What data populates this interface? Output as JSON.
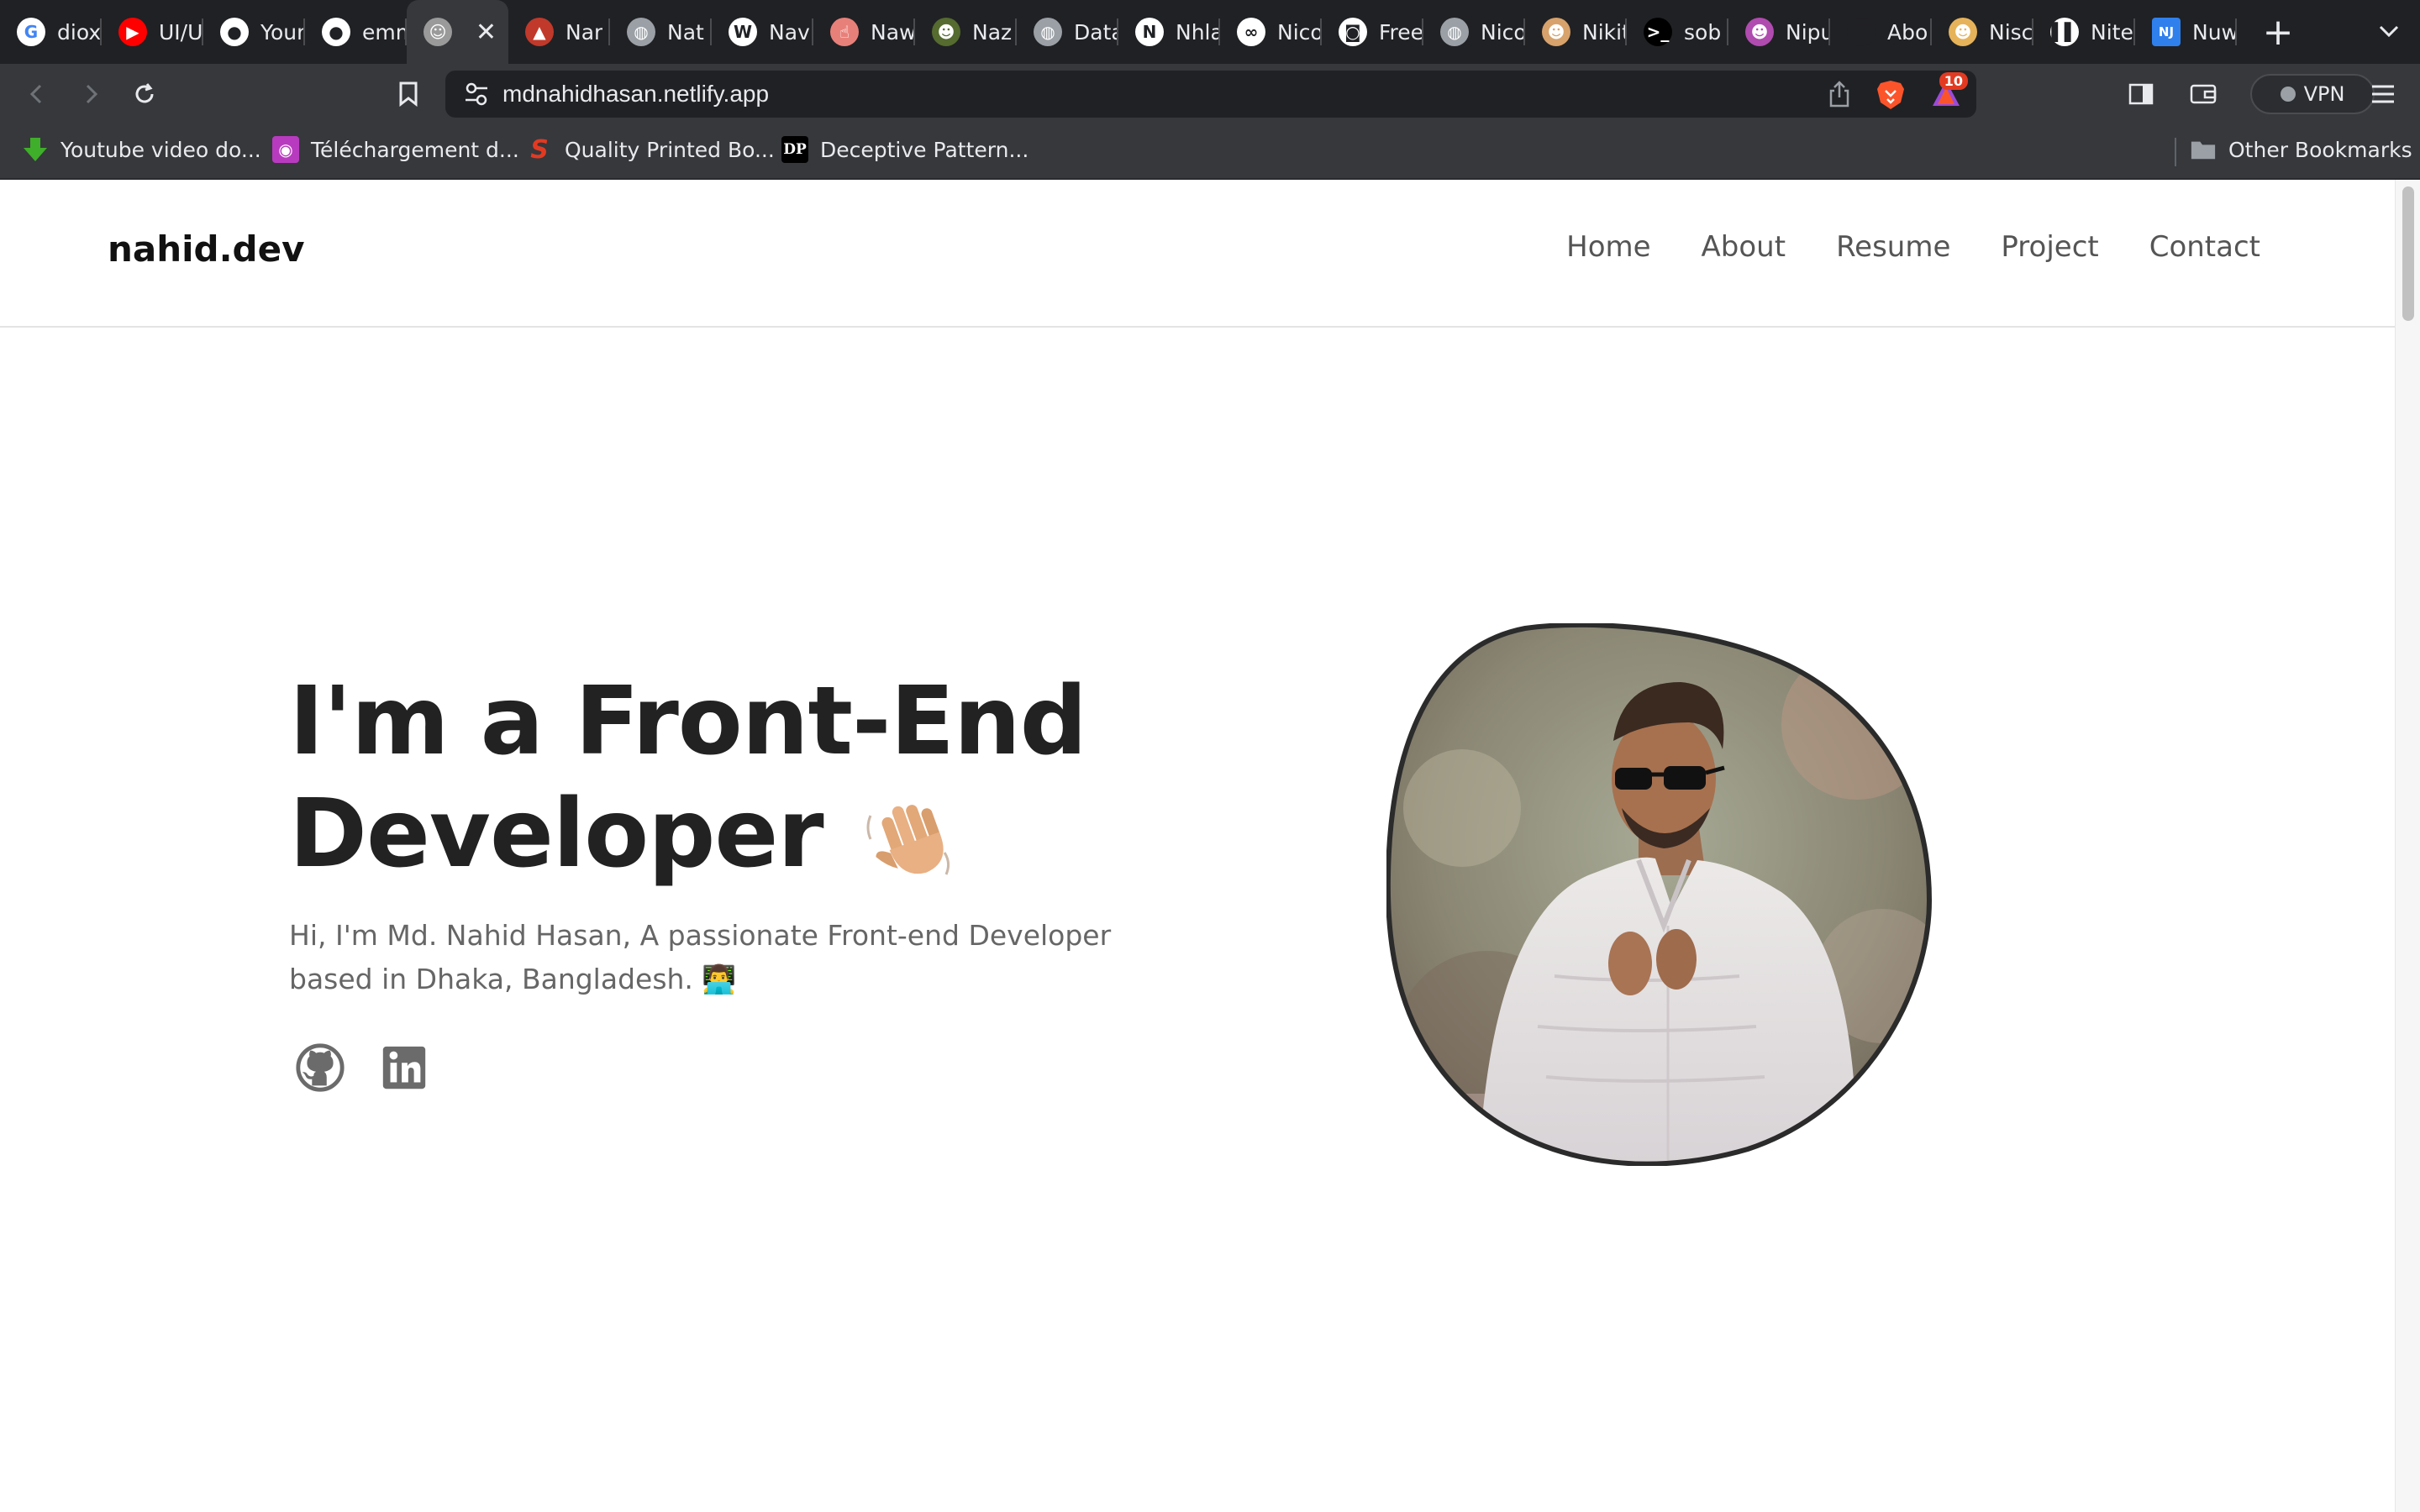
{
  "browser": {
    "tabs": [
      {
        "title": "diox",
        "favicon": "google-icon",
        "color": "#ffffff"
      },
      {
        "title": "UI/U",
        "favicon": "youtube-icon",
        "color": "#ff0000"
      },
      {
        "title": "Your",
        "favicon": "github-icon",
        "color": "#ffffff"
      },
      {
        "title": "emm",
        "favicon": "github-icon",
        "color": "#ffffff"
      },
      {
        "title": "",
        "favicon": "profile-icon",
        "color": "#9a9a9a",
        "active": true
      },
      {
        "title": "Nar",
        "favicon": "image-icon",
        "color": "#c0392b"
      },
      {
        "title": "Nat",
        "favicon": "globe-icon",
        "color": "#9aa0a6"
      },
      {
        "title": "Nav",
        "favicon": "wordpress-icon",
        "color": "#ffffff"
      },
      {
        "title": "Naw",
        "favicon": "cursor-icon",
        "color": "#e8807a"
      },
      {
        "title": "Naz",
        "favicon": "avatar-icon",
        "color": "#556b2f"
      },
      {
        "title": "Data",
        "favicon": "globe-icon",
        "color": "#9aa0a6"
      },
      {
        "title": "Nhla",
        "favicon": "notion-icon",
        "color": "#ffffff"
      },
      {
        "title": "Nico",
        "favicon": "link-icon",
        "color": "#ffffff"
      },
      {
        "title": "Free",
        "favicon": "mask-icon",
        "color": "#ffffff"
      },
      {
        "title": "Nico",
        "favicon": "globe-icon",
        "color": "#9aa0a6"
      },
      {
        "title": "Nikit",
        "favicon": "avatar-icon",
        "color": "#d7a26b"
      },
      {
        "title": "sob",
        "favicon": "terminal-icon",
        "color": "#000000"
      },
      {
        "title": "Nipu",
        "favicon": "avatar-icon",
        "color": "#b04bb0"
      },
      {
        "title": "Abo",
        "favicon": "blank-icon",
        "color": "#202124"
      },
      {
        "title": "Nisc",
        "favicon": "avatar-icon",
        "color": "#e6b35a"
      },
      {
        "title": "Nite",
        "favicon": "bars-icon",
        "color": "#ffffff"
      },
      {
        "title": "Nuw",
        "favicon": "nj-icon",
        "color": "#2f80ed"
      }
    ],
    "url": "mdnahidhasan.netlify.app",
    "rewards_badge": "10",
    "vpn_label": "VPN",
    "bookmarks": [
      {
        "label": "Youtube video do...",
        "icon": "download-icon"
      },
      {
        "label": "Téléchargement d...",
        "icon": "media-icon"
      },
      {
        "label": "Quality Printed Bo...",
        "icon": "s-logo-icon"
      },
      {
        "label": "Deceptive Pattern...",
        "icon": "dp-icon"
      }
    ],
    "other_bookmarks": "Other Bookmarks",
    "colors": {
      "chrome_dark": "#202124",
      "chrome_mid": "#36383c",
      "text": "#e8eaed"
    }
  },
  "site": {
    "logo": "nahid.dev",
    "nav": [
      "Home",
      "About",
      "Resume",
      "Project",
      "Contact"
    ],
    "hero": {
      "title_line1": "I'm a Front-End",
      "title_line2": "Developer",
      "subtitle": "Hi, I'm Md. Nahid Hasan, A passionate Front-end Developer based in Dhaka, Bangladesh. 👨‍💻"
    },
    "social": [
      "github-icon",
      "linkedin-icon"
    ]
  }
}
